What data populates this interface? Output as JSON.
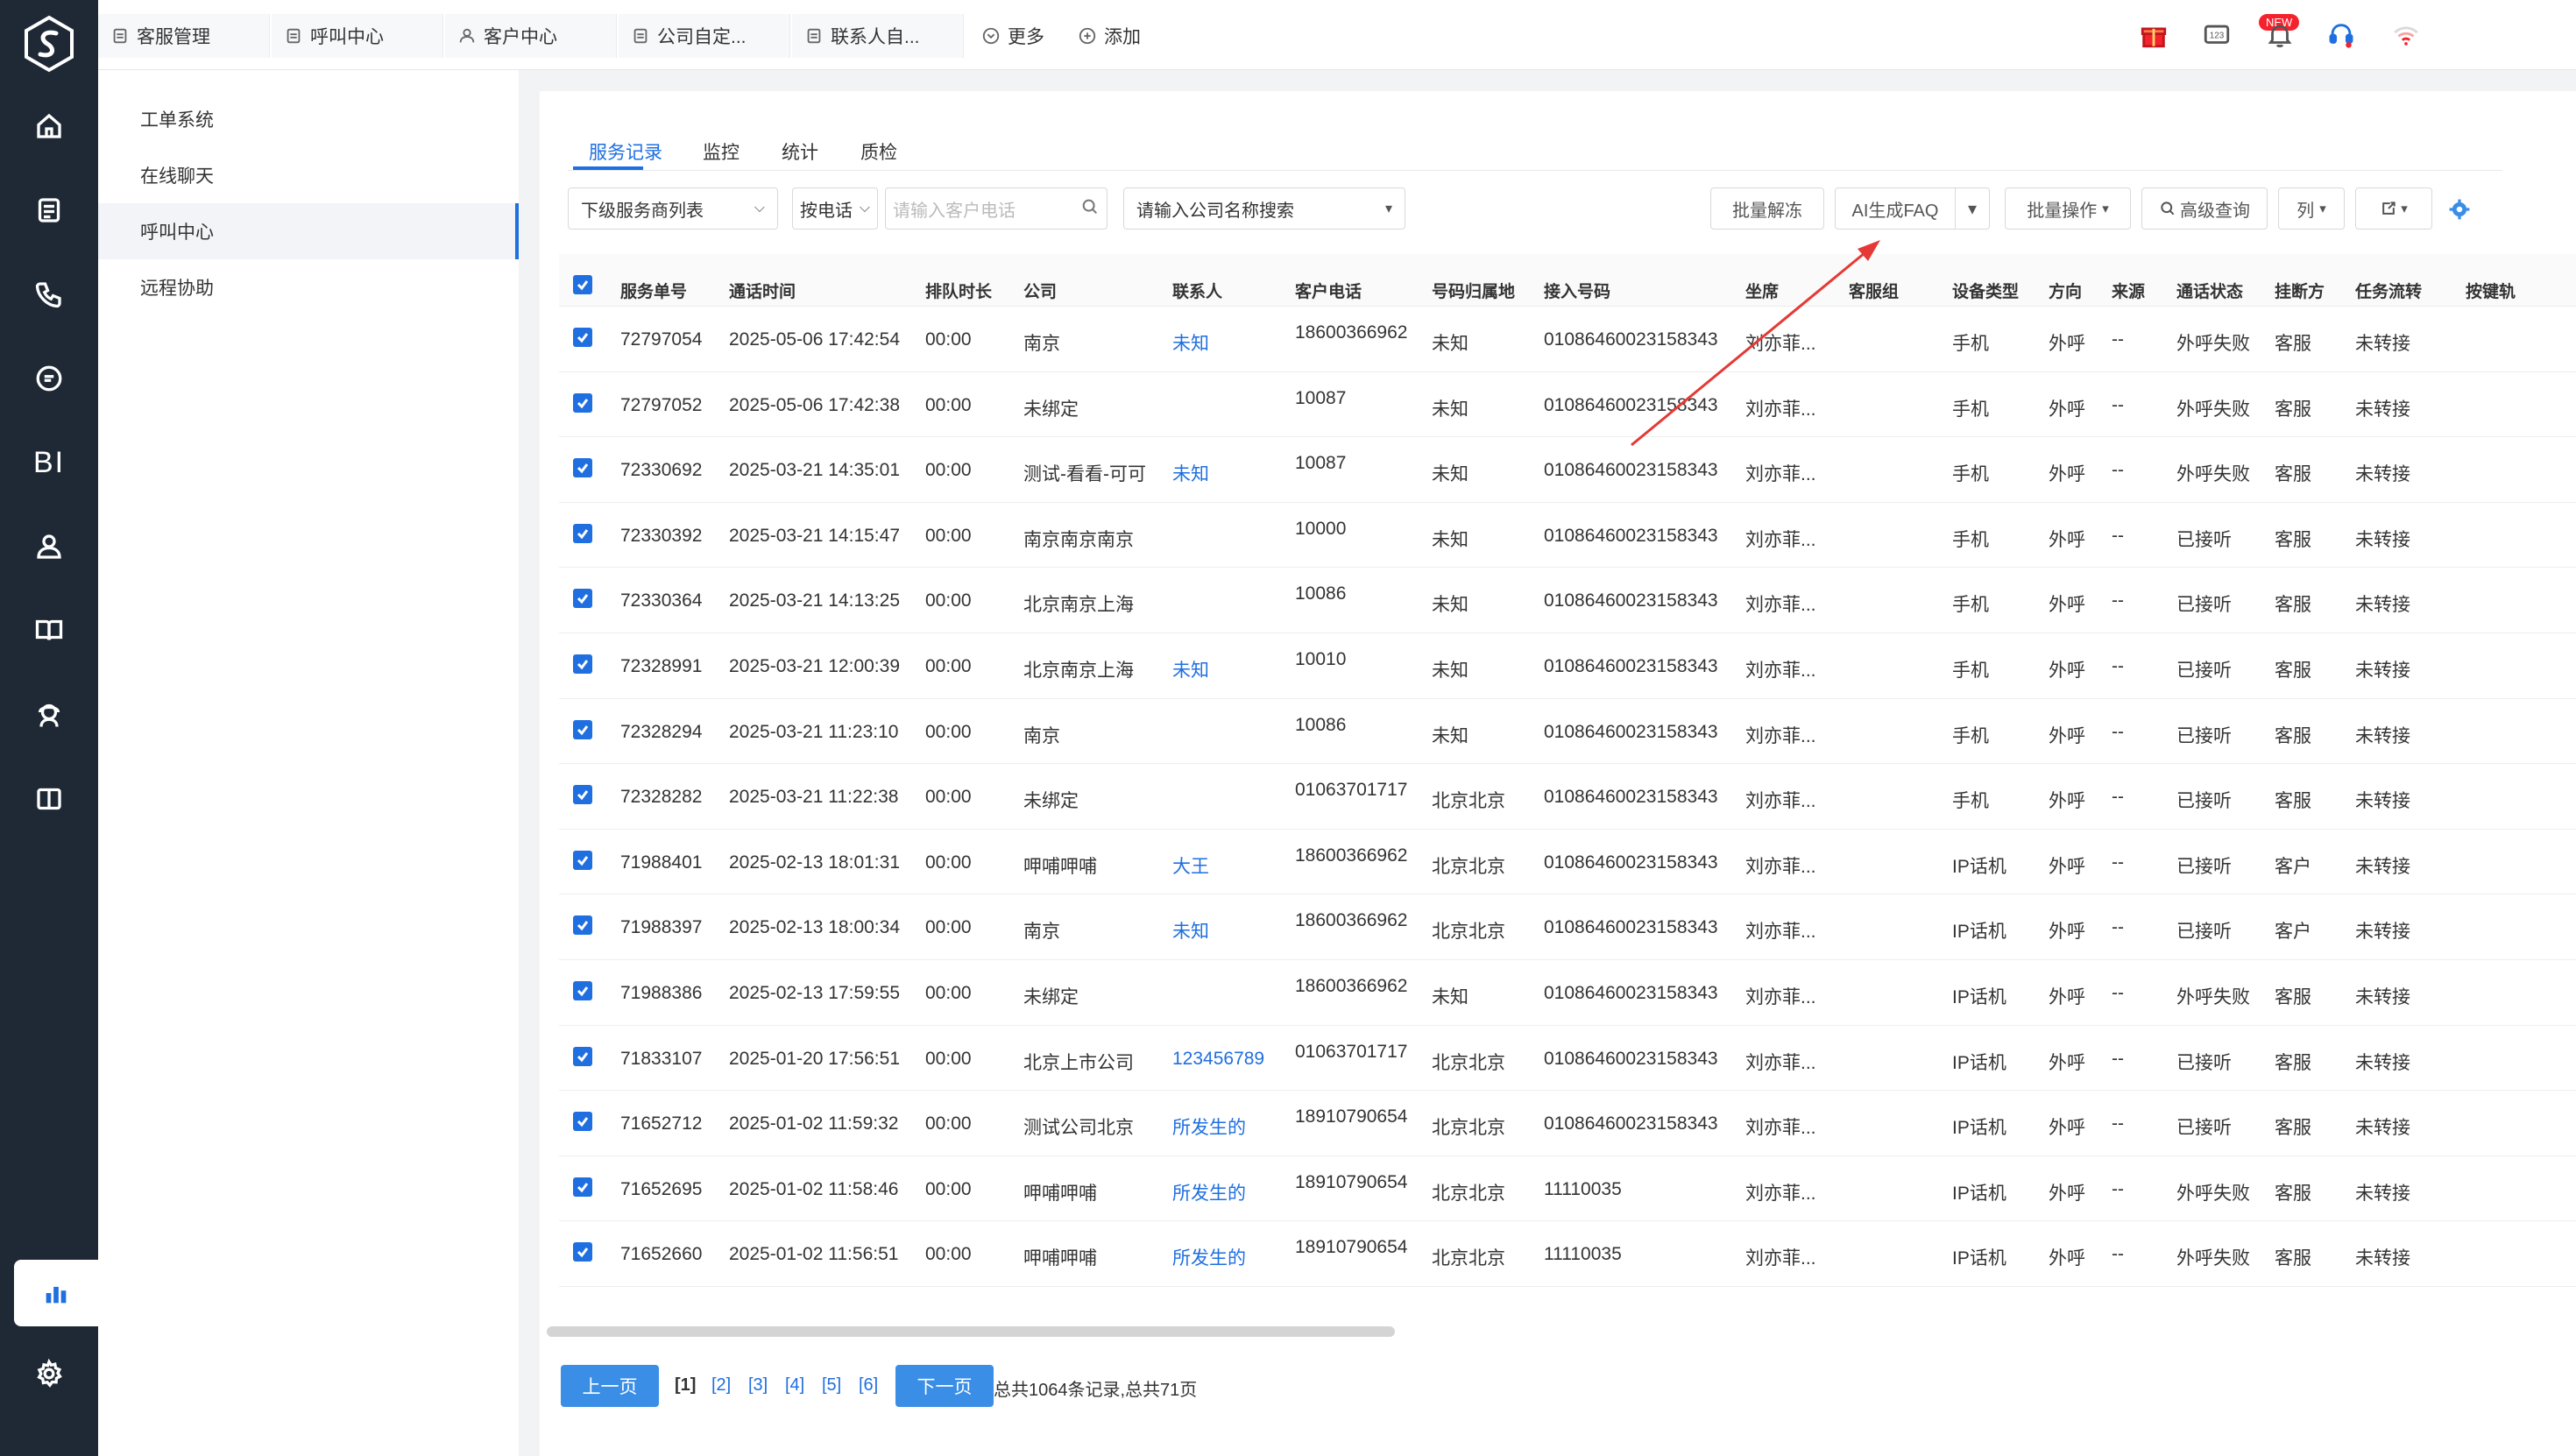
{
  "top_tabs": [
    "客服管理",
    "呼叫中心",
    "客户中心",
    "公司自定...",
    "联系人自..."
  ],
  "top_links": {
    "more": "更多",
    "add": "添加"
  },
  "badge_new": "NEW",
  "sidebar": {
    "items": [
      "工单系统",
      "在线聊天",
      "呼叫中心",
      "远程协助"
    ],
    "active_index": 2
  },
  "main_tabs": [
    "服务记录",
    "监控",
    "统计",
    "质检"
  ],
  "filters": {
    "provider_select": "下级服务商列表",
    "phone_select": "按电话",
    "phone_placeholder": "请输入客户电话",
    "company_placeholder": "请输入公司名称搜索"
  },
  "actions": {
    "batch_unlock": "批量解冻",
    "ai_faq": "AI生成FAQ",
    "batch_ops": "批量操作",
    "advanced": "高级查询",
    "columns": "列"
  },
  "columns": [
    "服务单号",
    "通话时间",
    "排队时长",
    "公司",
    "联系人",
    "客户电话",
    "号码归属地",
    "接入号码",
    "坐席",
    "客服组",
    "设备类型",
    "方向",
    "来源",
    "通话状态",
    "挂断方",
    "任务流转",
    "按键轨"
  ],
  "rows": [
    [
      "72797054",
      "2025-05-06 17:42:54",
      "00:00",
      "南京",
      "未知",
      "18600366962",
      "未知",
      "01086460023158343",
      "刘亦菲...",
      "",
      "手机",
      "外呼",
      "--",
      "外呼失败",
      "客服",
      "未转接"
    ],
    [
      "72797052",
      "2025-05-06 17:42:38",
      "00:00",
      "未绑定",
      "",
      "10087",
      "未知",
      "01086460023158343",
      "刘亦菲...",
      "",
      "手机",
      "外呼",
      "--",
      "外呼失败",
      "客服",
      "未转接"
    ],
    [
      "72330692",
      "2025-03-21 14:35:01",
      "00:00",
      "测试-看看-可可",
      "未知",
      "10087",
      "未知",
      "01086460023158343",
      "刘亦菲...",
      "",
      "手机",
      "外呼",
      "--",
      "外呼失败",
      "客服",
      "未转接"
    ],
    [
      "72330392",
      "2025-03-21 14:15:47",
      "00:00",
      "南京南京南京",
      "",
      "10000",
      "未知",
      "01086460023158343",
      "刘亦菲...",
      "",
      "手机",
      "外呼",
      "--",
      "已接听",
      "客服",
      "未转接"
    ],
    [
      "72330364",
      "2025-03-21 14:13:25",
      "00:00",
      "北京南京上海",
      "",
      "10086",
      "未知",
      "01086460023158343",
      "刘亦菲...",
      "",
      "手机",
      "外呼",
      "--",
      "已接听",
      "客服",
      "未转接"
    ],
    [
      "72328991",
      "2025-03-21 12:00:39",
      "00:00",
      "北京南京上海",
      "未知",
      "10010",
      "未知",
      "01086460023158343",
      "刘亦菲...",
      "",
      "手机",
      "外呼",
      "--",
      "已接听",
      "客服",
      "未转接"
    ],
    [
      "72328294",
      "2025-03-21 11:23:10",
      "00:00",
      "南京",
      "",
      "10086",
      "未知",
      "01086460023158343",
      "刘亦菲...",
      "",
      "手机",
      "外呼",
      "--",
      "已接听",
      "客服",
      "未转接"
    ],
    [
      "72328282",
      "2025-03-21 11:22:38",
      "00:00",
      "未绑定",
      "",
      "01063701717",
      "北京北京",
      "01086460023158343",
      "刘亦菲...",
      "",
      "手机",
      "外呼",
      "--",
      "已接听",
      "客服",
      "未转接"
    ],
    [
      "71988401",
      "2025-02-13 18:01:31",
      "00:00",
      "呷哺呷哺",
      "大王",
      "18600366962",
      "北京北京",
      "01086460023158343",
      "刘亦菲...",
      "",
      "IP话机",
      "外呼",
      "--",
      "已接听",
      "客户",
      "未转接"
    ],
    [
      "71988397",
      "2025-02-13 18:00:34",
      "00:00",
      "南京",
      "未知",
      "18600366962",
      "北京北京",
      "01086460023158343",
      "刘亦菲...",
      "",
      "IP话机",
      "外呼",
      "--",
      "已接听",
      "客户",
      "未转接"
    ],
    [
      "71988386",
      "2025-02-13 17:59:55",
      "00:00",
      "未绑定",
      "",
      "18600366962",
      "未知",
      "01086460023158343",
      "刘亦菲...",
      "",
      "IP话机",
      "外呼",
      "--",
      "外呼失败",
      "客服",
      "未转接"
    ],
    [
      "71833107",
      "2025-01-20 17:56:51",
      "00:00",
      "北京上市公司",
      "123456789",
      "01063701717",
      "北京北京",
      "01086460023158343",
      "刘亦菲...",
      "",
      "IP话机",
      "外呼",
      "--",
      "已接听",
      "客服",
      "未转接"
    ],
    [
      "71652712",
      "2025-01-02 11:59:32",
      "00:00",
      "测试公司北京",
      "所发生的",
      "18910790654",
      "北京北京",
      "01086460023158343",
      "刘亦菲...",
      "",
      "IP话机",
      "外呼",
      "--",
      "已接听",
      "客服",
      "未转接"
    ],
    [
      "71652695",
      "2025-01-02 11:58:46",
      "00:00",
      "呷哺呷哺",
      "所发生的",
      "18910790654",
      "北京北京",
      "11110035",
      "刘亦菲...",
      "",
      "IP话机",
      "外呼",
      "--",
      "外呼失败",
      "客服",
      "未转接"
    ],
    [
      "71652660",
      "2025-01-02 11:56:51",
      "00:00",
      "呷哺呷哺",
      "所发生的",
      "18910790654",
      "北京北京",
      "11110035",
      "刘亦菲...",
      "",
      "IP话机",
      "外呼",
      "--",
      "外呼失败",
      "客服",
      "未转接"
    ]
  ],
  "pagination": {
    "prev": "上一页",
    "next": "下一页",
    "pages": [
      "[1]",
      "[2]",
      "[3]",
      "[4]",
      "[5]",
      "[6]"
    ],
    "current_index": 0,
    "total": "总共1064条记录,总共71页"
  },
  "colors": {
    "accent": "#1f6fe0",
    "rail": "#1f2935",
    "annotation": "#e53935"
  }
}
